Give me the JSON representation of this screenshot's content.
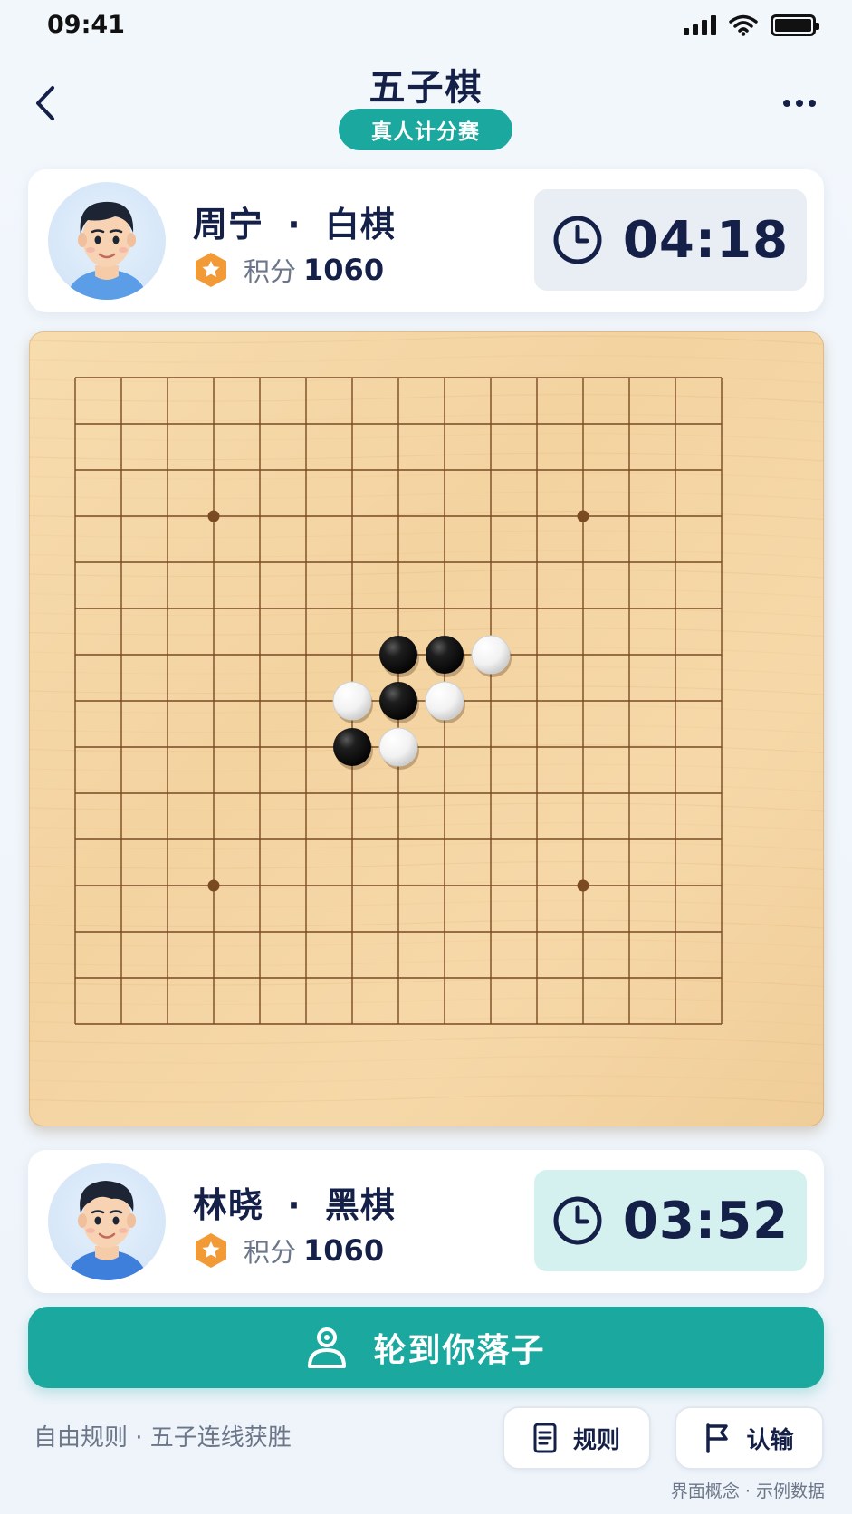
{
  "status_bar": {
    "time": "09:41"
  },
  "header": {
    "title": "五子棋",
    "badge": "真人计分赛"
  },
  "opponent": {
    "name": "周宁",
    "separator": "·",
    "color": "白棋",
    "score_label": "积分",
    "score": "1060",
    "timer": "04:18"
  },
  "player": {
    "name": "林晓",
    "separator": "·",
    "color": "黑棋",
    "score_label": "积分",
    "score": "1060",
    "timer": "03:52"
  },
  "board": {
    "size": 15,
    "star_points": [
      [
        3,
        3
      ],
      [
        3,
        11
      ],
      [
        11,
        3
      ],
      [
        11,
        11
      ]
    ],
    "stones": [
      {
        "col": 7,
        "row": 6,
        "color": "black"
      },
      {
        "col": 8,
        "row": 6,
        "color": "black"
      },
      {
        "col": 9,
        "row": 6,
        "color": "white"
      },
      {
        "col": 6,
        "row": 7,
        "color": "white"
      },
      {
        "col": 7,
        "row": 7,
        "color": "black"
      },
      {
        "col": 8,
        "row": 7,
        "color": "white"
      },
      {
        "col": 6,
        "row": 8,
        "color": "black"
      },
      {
        "col": 7,
        "row": 8,
        "color": "white"
      }
    ]
  },
  "turn_button": {
    "label": "轮到你落子"
  },
  "footer": {
    "rules_text": "自由规则 · 五子连线获胜",
    "rules_button": "规则",
    "resign_button": "认输",
    "note": "界面概念 · 示例数据"
  },
  "colors": {
    "accent": "#1aa89f",
    "navy": "#152048",
    "board": "#f5d6a4",
    "grid_line": "#7a4a22",
    "star_icon": "#f29a35"
  },
  "icons": {
    "back": "chevron-left-icon",
    "more": "more-dots-icon",
    "clock": "clock-icon",
    "score": "star-hex-icon",
    "turn": "user-icon",
    "rules": "document-icon",
    "resign": "flag-icon"
  }
}
